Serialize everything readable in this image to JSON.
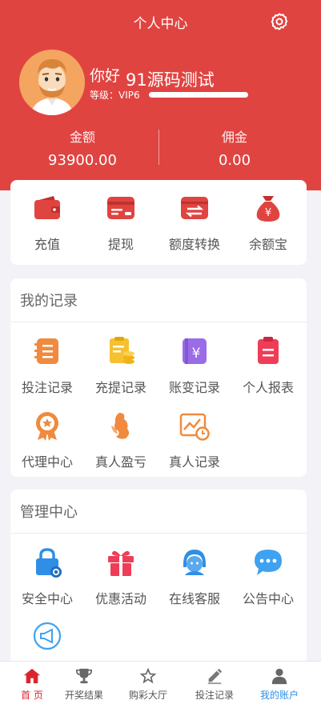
{
  "header": {
    "title": "个人中心",
    "settings_icon": "gear-icon",
    "bg_color": "#e04441"
  },
  "profile": {
    "greeting": "你好",
    "username": "91源码测试",
    "level_label": "等级：VIP6",
    "level_progress": 1.0
  },
  "balance": {
    "label": "金额",
    "value": "93900.00"
  },
  "commission": {
    "label": "佣金",
    "value": "0.00"
  },
  "wallet_actions": [
    {
      "label": "充值",
      "icon": "wallet-icon"
    },
    {
      "label": "提现",
      "icon": "card-icon"
    },
    {
      "label": "额度转换",
      "icon": "transfer-icon"
    },
    {
      "label": "余额宝",
      "icon": "money-bag-icon"
    }
  ],
  "records": {
    "title": "我的记录",
    "items": [
      {
        "label": "投注记录",
        "icon": "bet-record-icon"
      },
      {
        "label": "充提记录",
        "icon": "deposit-record-icon"
      },
      {
        "label": "账变记录",
        "icon": "account-change-icon"
      },
      {
        "label": "个人报表",
        "icon": "report-icon"
      },
      {
        "label": "代理中心",
        "icon": "agent-medal-icon"
      },
      {
        "label": "真人盈亏",
        "icon": "live-profit-icon"
      },
      {
        "label": "真人记录",
        "icon": "live-record-icon"
      }
    ]
  },
  "management": {
    "title": "管理中心",
    "items": [
      {
        "label": "安全中心",
        "icon": "lock-icon"
      },
      {
        "label": "优惠活动",
        "icon": "gift-icon"
      },
      {
        "label": "在线客服",
        "icon": "customer-service-icon"
      },
      {
        "label": "公告中心",
        "icon": "chat-bubble-icon"
      },
      {
        "label": "",
        "icon": "megaphone-icon"
      }
    ]
  },
  "tabbar": {
    "active_color": "#2f8ee6",
    "home_color": "#d9262c",
    "items": [
      {
        "label": "首 页",
        "icon": "home-icon"
      },
      {
        "label": "开奖结果",
        "icon": "trophy-icon"
      },
      {
        "label": "购彩大厅",
        "icon": "star-icon"
      },
      {
        "label": "投注记录",
        "icon": "pencil-note-icon"
      },
      {
        "label": "我的账户",
        "icon": "user-icon"
      }
    ]
  }
}
